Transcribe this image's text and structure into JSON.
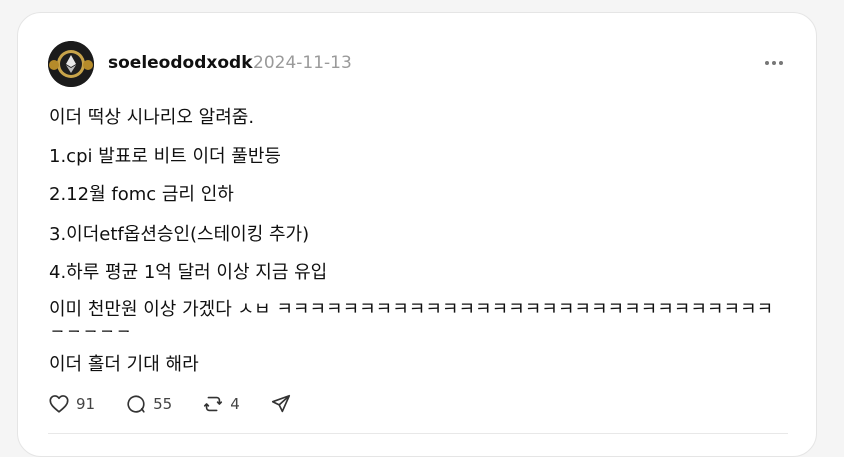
{
  "post": {
    "username": "soeleododxodk",
    "date": "2024-11-13",
    "lines": [
      "이더 떡상 시나리오 알려줌.",
      "1.cpi 발표로 비트 이더 풀반등",
      "2.12월 fomc 금리 인하",
      "3.이더etf옵션승인(스테이킹 추가)",
      "4.하루 평균 1억 달러 이상 지금 유입",
      "이미 천만원 이상 가겠다 ㅅㅂ ㅋㅋㅋㅋㅋㅋㅋㅋㅋㅋㅋㅋㅋㅋㅋㅋㅋㅋㅋㅋㅋㅋㅋㅋㅋㅋㅋㅋㅋㅋㅋㅋㅋㅋㅋ",
      "이더 홀더 기대 해라"
    ],
    "likes": "91",
    "comments": "55",
    "reposts": "4"
  },
  "icons": {
    "more": "more-dots-icon",
    "like": "heart-icon",
    "comment": "comment-icon",
    "repost": "repost-icon",
    "share": "send-icon",
    "avatar": "ethereum-coin-icon"
  }
}
